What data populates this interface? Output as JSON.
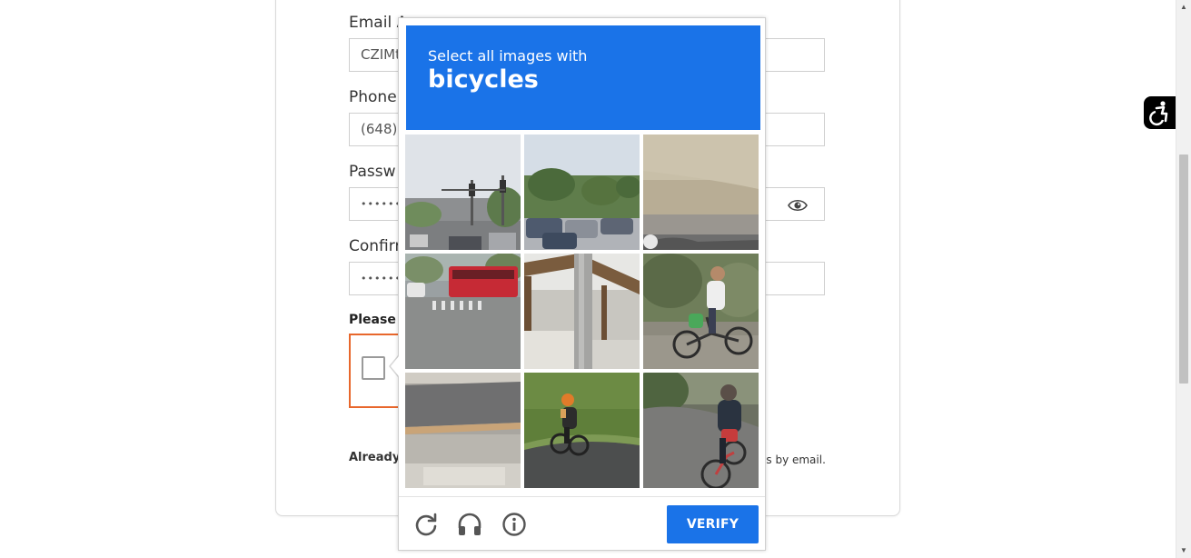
{
  "form": {
    "email": {
      "label": "Email A",
      "value": "CZIMt"
    },
    "phone": {
      "label": "Phone:",
      "value": "(648)"
    },
    "password": {
      "label": "Passw",
      "value": "••••••••"
    },
    "confirm": {
      "label": "Confirr",
      "value": "••••••••"
    },
    "consent_label": "Please c",
    "already_text": "Already",
    "email_note": "es by email."
  },
  "captcha": {
    "instruction": "Select all images with",
    "target": "bicycles",
    "tiles": [
      {
        "id": 1,
        "scene": "street with traffic lights"
      },
      {
        "id": 2,
        "scene": "parking lot with cars"
      },
      {
        "id": 3,
        "scene": "stone wall and road edge"
      },
      {
        "id": 4,
        "scene": "red bus at crosswalk"
      },
      {
        "id": 5,
        "scene": "pole and wooden pergola"
      },
      {
        "id": 6,
        "scene": "man riding bicycle"
      },
      {
        "id": 7,
        "scene": "asphalt road corner"
      },
      {
        "id": 8,
        "scene": "cyclist on grassy path"
      },
      {
        "id": 9,
        "scene": "person riding bicycle on road"
      }
    ],
    "verify_label": "VERIFY",
    "header_color": "#1a73e8"
  },
  "icons": {
    "reload": "reload-icon",
    "audio": "headphones-icon",
    "info": "info-icon",
    "eye": "eye-icon",
    "accessibility": "accessibility-icon"
  }
}
